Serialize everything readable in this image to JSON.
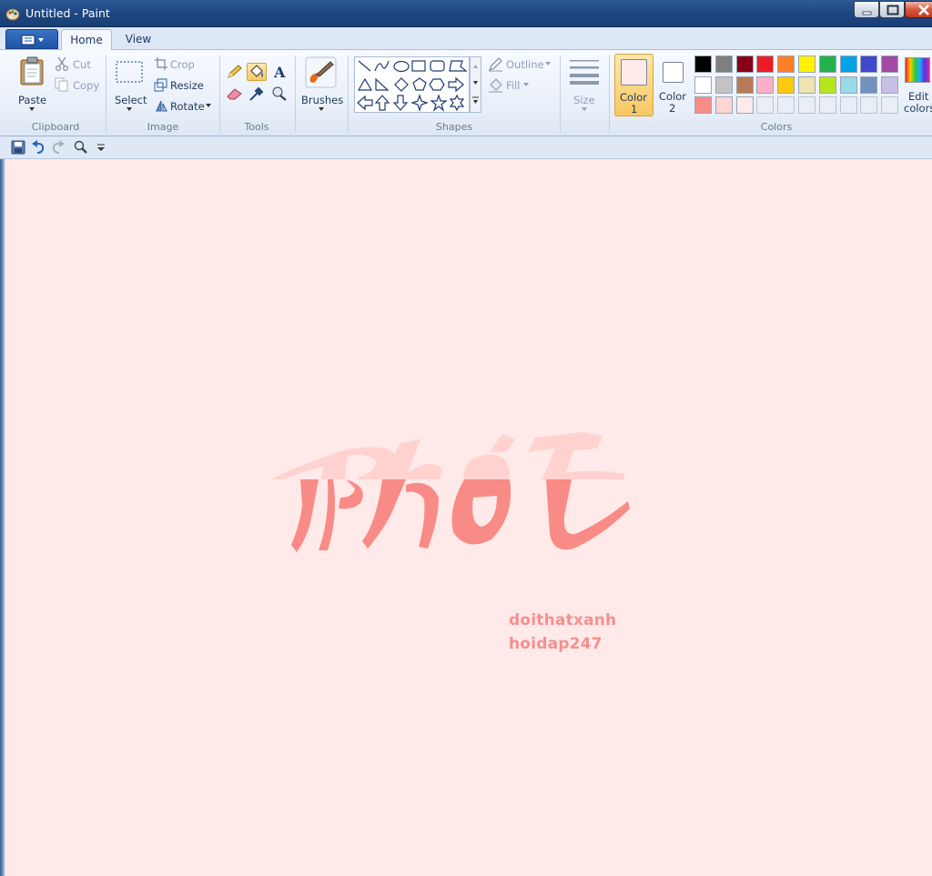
{
  "window": {
    "title": "Untitled - Paint"
  },
  "tabs": [
    {
      "label": "Home",
      "active": true
    },
    {
      "label": "View",
      "active": false
    }
  ],
  "clipboard": {
    "group_label": "Clipboard",
    "paste": "Paste",
    "cut": "Cut",
    "copy": "Copy"
  },
  "image": {
    "group_label": "Image",
    "select": "Select",
    "crop": "Crop",
    "resize": "Resize",
    "rotate": "Rotate"
  },
  "tools": {
    "group_label": "Tools",
    "selected_tool": "fill-icon"
  },
  "brushes": {
    "label": "Brushes"
  },
  "shapes": {
    "group_label": "Shapes",
    "outline": "Outline",
    "fill": "Fill"
  },
  "size": {
    "label": "Size"
  },
  "colors": {
    "group_label": "Colors",
    "color1_label_line1": "Color",
    "color1_label_line2": "1",
    "color2_label_line1": "Color",
    "color2_label_line2": "2",
    "color1": "#ffe9e9",
    "color2": "#ffffff",
    "edit_line1": "Edit",
    "edit_line2": "colors",
    "palette": [
      [
        "#000000",
        "#7f7f7f",
        "#880015",
        "#ed1c24",
        "#ff7f27",
        "#fff200",
        "#22b14c",
        "#00a2e8",
        "#3f48cc",
        "#a349a4"
      ],
      [
        "#ffffff",
        "#c3c3c3",
        "#b97a57",
        "#ffaec9",
        "#ffc90e",
        "#efe4b0",
        "#b5e61d",
        "#99d9ea",
        "#7092be",
        "#c8bfe7"
      ],
      [
        "#f98b86",
        "#ffd5d2",
        "#ffeaea",
        "",
        "",
        "",
        "",
        "",
        "",
        ""
      ]
    ]
  },
  "canvas": {
    "background": "#ffe9e9",
    "artwork_word": "Phốt",
    "watermark_line1": "doithatxanh",
    "watermark_line2": "hoidap247"
  }
}
